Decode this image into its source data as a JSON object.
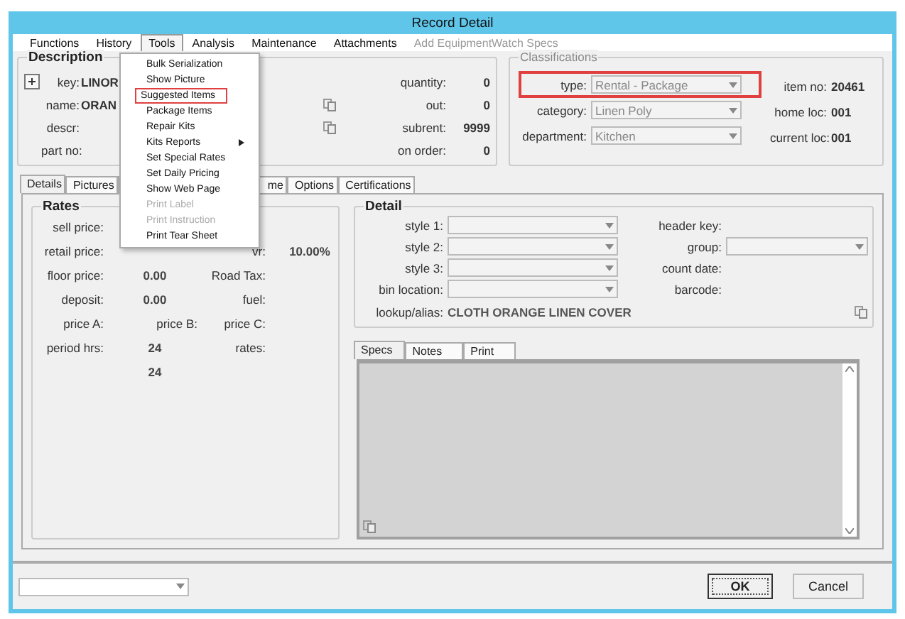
{
  "window": {
    "title": "Record Detail"
  },
  "menubar": [
    {
      "label": "Functions",
      "selected": false,
      "disabled": false
    },
    {
      "label": "History",
      "selected": false,
      "disabled": false
    },
    {
      "label": "Tools",
      "selected": true,
      "disabled": false
    },
    {
      "label": "Analysis",
      "selected": false,
      "disabled": false
    },
    {
      "label": "Maintenance",
      "selected": false,
      "disabled": false
    },
    {
      "label": "Attachments",
      "selected": false,
      "disabled": false
    },
    {
      "label": "Add EquipmentWatch Specs",
      "selected": false,
      "disabled": true
    }
  ],
  "tools_menu": [
    {
      "label": "Bulk Serialization",
      "disabled": false,
      "submenu": false,
      "highlighted": false
    },
    {
      "label": "Show Picture",
      "disabled": false,
      "submenu": false,
      "highlighted": false
    },
    {
      "label": "Suggested Items",
      "disabled": false,
      "submenu": false,
      "highlighted": true
    },
    {
      "label": "Package Items",
      "disabled": false,
      "submenu": false,
      "highlighted": false
    },
    {
      "label": "Repair Kits",
      "disabled": false,
      "submenu": false,
      "highlighted": false
    },
    {
      "label": "Kits Reports",
      "disabled": false,
      "submenu": true,
      "highlighted": false
    },
    {
      "label": "Set Special Rates",
      "disabled": false,
      "submenu": false,
      "highlighted": false
    },
    {
      "label": "Set Daily Pricing",
      "disabled": false,
      "submenu": false,
      "highlighted": false
    },
    {
      "label": "Show Web Page",
      "disabled": false,
      "submenu": false,
      "highlighted": false
    },
    {
      "label": "Print Label",
      "disabled": true,
      "submenu": false,
      "highlighted": false
    },
    {
      "label": "Print Instruction",
      "disabled": true,
      "submenu": false,
      "highlighted": false
    },
    {
      "label": "Print Tear Sheet",
      "disabled": false,
      "submenu": false,
      "highlighted": false
    }
  ],
  "description": {
    "title": "Description",
    "fields": [
      {
        "label": "key:",
        "value": "LINOR"
      },
      {
        "label": "name:",
        "value": "ORAN"
      },
      {
        "label": "descr:"
      },
      {
        "label": "part no:"
      }
    ],
    "counts": [
      {
        "label": "quantity:",
        "value": "0",
        "copy_icon": false
      },
      {
        "label": "out:",
        "value": "0",
        "copy_icon": true
      },
      {
        "label": "subrent:",
        "value": "9999",
        "copy_icon": true
      },
      {
        "label": "on order:",
        "value": "0",
        "copy_icon": false
      }
    ]
  },
  "classifications": {
    "title": "Classifications",
    "fields": [
      {
        "label": "type:",
        "value": "Rental - Package",
        "highlighted": true
      },
      {
        "label": "category:",
        "value": "Linen Poly",
        "highlighted": false
      },
      {
        "label": "department:",
        "value": "Kitchen",
        "highlighted": false
      }
    ],
    "info": [
      {
        "label": "item no:",
        "value": "20461"
      },
      {
        "label": "home loc:",
        "value": "001"
      },
      {
        "label": "current loc:",
        "value": "001"
      }
    ]
  },
  "tabs": [
    {
      "label": "Details",
      "selected": true
    },
    {
      "label": "Pictures",
      "selected": false
    },
    {
      "label": "me",
      "selected": false
    },
    {
      "label": "Options",
      "selected": false
    },
    {
      "label": "Certifications",
      "selected": false
    }
  ],
  "rates": {
    "title": "Rates",
    "rows": [
      [
        {
          "kind": "label",
          "text": "sell price:"
        }
      ],
      [
        {
          "kind": "label",
          "text": "retail price:"
        },
        {
          "kind": "gap"
        },
        {
          "kind": "label",
          "text": "vr:"
        },
        {
          "kind": "value",
          "text": "10.00%"
        }
      ],
      [
        {
          "kind": "label",
          "text": "floor price:"
        },
        {
          "kind": "value",
          "text": "0.00"
        },
        {
          "kind": "label",
          "text": "Road Tax:"
        }
      ],
      [
        {
          "kind": "label",
          "text": "deposit:"
        },
        {
          "kind": "value",
          "text": "0.00"
        },
        {
          "kind": "label",
          "text": "fuel:"
        }
      ],
      [
        {
          "kind": "label",
          "text": "price A:"
        },
        {
          "kind": "label",
          "text": "price B:"
        },
        {
          "kind": "label",
          "text": "price C:"
        }
      ],
      [
        {
          "kind": "label",
          "text": "period hrs:"
        },
        {
          "kind": "value",
          "text": "24"
        },
        {
          "kind": "label",
          "text": "rates:"
        }
      ],
      [
        {
          "kind": "gap"
        },
        {
          "kind": "value",
          "text": "24"
        }
      ]
    ]
  },
  "detail": {
    "title": "Detail",
    "combos": [
      {
        "label": "style 1:"
      },
      {
        "label": "style 2:"
      },
      {
        "label": "style 3:"
      },
      {
        "label": "bin location:"
      }
    ],
    "right": [
      {
        "label": "header key:",
        "kind": "text"
      },
      {
        "label": "group:",
        "kind": "combo"
      },
      {
        "label": "count date:",
        "kind": "text"
      },
      {
        "label": "barcode:",
        "kind": "text"
      }
    ],
    "lookup": {
      "label": "lookup/alias:",
      "value": "CLOTH ORANGE LINEN COVER"
    }
  },
  "sub_tabs": [
    {
      "label": "Specs",
      "selected": true
    },
    {
      "label": "Notes",
      "selected": false
    },
    {
      "label": "Print",
      "selected": false
    }
  ],
  "buttons": [
    {
      "label": "OK",
      "default": true
    },
    {
      "label": "Cancel",
      "default": false
    }
  ]
}
